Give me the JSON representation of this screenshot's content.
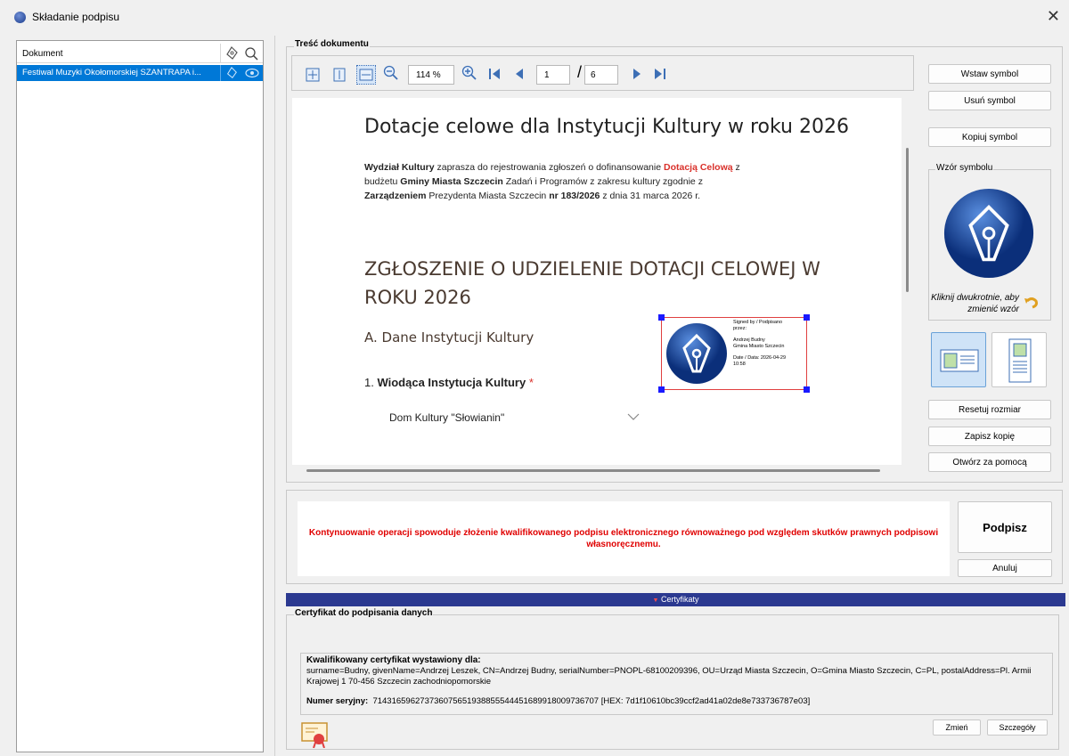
{
  "window": {
    "title": "Składanie podpisu"
  },
  "left_panel": {
    "header": "Dokument",
    "rows": [
      {
        "name": "Festiwal Muzyki Okołomorskiej SZANTRAPA i..."
      }
    ]
  },
  "content_group": {
    "legend": "Treść dokumentu"
  },
  "toolbar": {
    "zoom": "114 %",
    "page": "1",
    "total_pages": "6"
  },
  "document": {
    "heading": "Dotacje celowe dla Instytucji Kultury w roku 2026",
    "intro": {
      "p1a": "Wydział Kultury",
      "p1b": " zaprasza do rejestrowania zgłoszeń o dofinansowanie ",
      "p1c": "Dotacją Celową",
      "p1d": " z budżetu ",
      "p1e": "Gminy Miasta Szczecin",
      "p1f": " Zadań i Programów z zakresu kultury zgodnie z ",
      "p1g": "Zarządzeniem",
      "p1h": " Prezydenta Miasta Szczecin ",
      "p1i": "nr 183/2026",
      "p1j": " z dnia 31 marca 2026 r."
    },
    "section_title": "ZGŁOSZENIE O UDZIELENIE DOTACJI CELOWEJ W ROKU 2026",
    "subsection": "A. Dane Instytucji Kultury",
    "question_num": "1.",
    "question": "Wiodąca Instytucja Kultury",
    "required_mark": "*",
    "answer": "Dom Kultury \"Słowianin\"",
    "signature": {
      "line1": "Signed by / Podpisano",
      "line2": "przez:",
      "line3": "Andrzej Budny",
      "line4": "Gmina Miasto Szczecin",
      "line5": "Date / Data: 2026-04-29",
      "line6": "10:58"
    }
  },
  "right_panel": {
    "insert_symbol": "Wstaw symbol",
    "remove_symbol": "Usuń symbol",
    "copy_symbol": "Kopiuj symbol",
    "pattern_legend": "Wzór symbolu",
    "pattern_hint": "Kliknij dwukrotnie, aby zmienić wzór",
    "reset_size": "Resetuj rozmiar",
    "save_copy": "Zapisz kopię",
    "open_with": "Otwórz za pomocą"
  },
  "sign_area": {
    "warning": "Kontynuowanie operacji spowoduje złożenie kwalifikowanego podpisu elektronicznego równoważnego pod względem skutków prawnych podpisowi własnoręcznemu.",
    "sign_button": "Podpisz",
    "cancel_button": "Anuluj"
  },
  "certificates": {
    "bar_label": "Certyfikaty",
    "legend": "Certyfikat do podpisania danych",
    "issued_for_label": "Kwalifikowany certyfikat wystawiony dla:",
    "subject": "surname=Budny, givenName=Andrzej Leszek, CN=Andrzej Budny, serialNumber=PNOPL-68100209396, OU=Urząd Miasta Szczecin, O=Gmina Miasto Szczecin, C=PL, postalAddress=Pl. Armii Krajowej 1 70-456 Szczecin zachodniopomorskie",
    "serial_label": "Numer seryjny:",
    "serial_value": "7143165962737360756519388555444516899180097367​07 [HEX: 7d1f10610bc39ccf2ad41a02de8e733736787e03]",
    "change_button": "Zmień",
    "details_button": "Szczegóły"
  },
  "colors": {
    "accent": "#0078d7",
    "bar": "#2b3990",
    "warning": "#e00000",
    "doc_red": "#d9302a"
  }
}
